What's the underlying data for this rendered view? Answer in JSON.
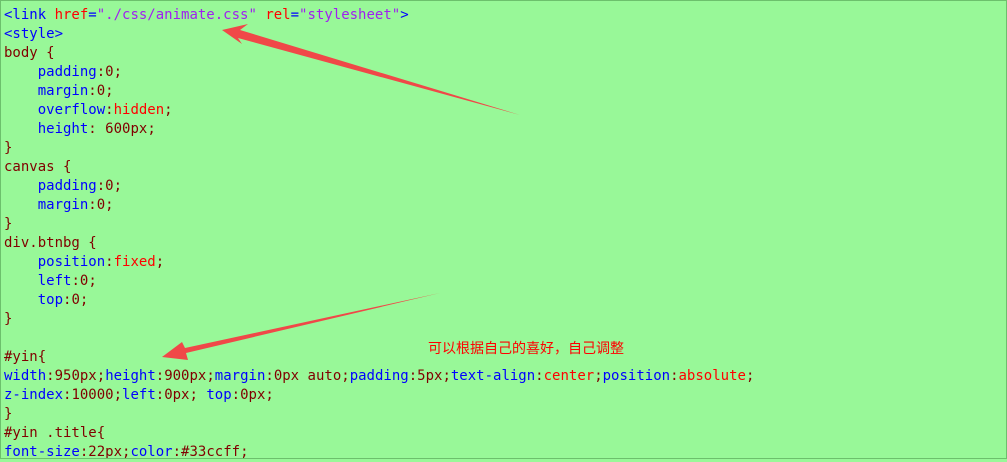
{
  "code": {
    "l1": {
      "open": "<link ",
      "href_attr": "href",
      "eq1": "=",
      "href_val": "\"./css/animate.css\"",
      "rel_attr": " rel",
      "eq2": "=",
      "rel_val": "\"stylesheet\"",
      "close": ">"
    },
    "l2": "<style>",
    "l3": "body {",
    "l4": {
      "prop": "padding",
      "val": "0"
    },
    "l5": {
      "prop": "margin",
      "val": "0"
    },
    "l6": {
      "prop": "overflow",
      "val": "hidden"
    },
    "l7": {
      "prop": "height",
      "val": " 600px"
    },
    "l8": "}",
    "l9": "canvas {",
    "l10": {
      "prop": "padding",
      "val": "0"
    },
    "l11": {
      "prop": "margin",
      "val": "0"
    },
    "l12": "}",
    "l13": "div.btnbg {",
    "l14": {
      "prop": "position",
      "val": "fixed"
    },
    "l15": {
      "prop": "left",
      "val": "0"
    },
    "l16": {
      "prop": "top",
      "val": "0"
    },
    "l17": "}",
    "l19": "#yin{",
    "l20": [
      {
        "prop": "width",
        "val": "950px"
      },
      {
        "prop": "height",
        "val": "900px"
      },
      {
        "prop": "margin",
        "val": "0px auto"
      },
      {
        "prop": "padding",
        "val": "5px"
      },
      {
        "prop": "text-align",
        "val": "center"
      },
      {
        "prop": "position",
        "val": "absolute"
      }
    ],
    "l21": [
      {
        "prop": "z-index",
        "val": "10000"
      },
      {
        "prop": "left",
        "val": "0px"
      },
      {
        "prop": " top",
        "val": "0px"
      }
    ],
    "l22": "}",
    "l23": "#yin .title{",
    "l24": [
      {
        "prop": "font-size",
        "val": "22px"
      },
      {
        "prop": "color",
        "val": "#33ccff"
      }
    ]
  },
  "annotation": {
    "text": "可以根据自己的喜好，自己调整"
  },
  "colors": {
    "background": "#98f898",
    "arrow": "#f04848"
  }
}
